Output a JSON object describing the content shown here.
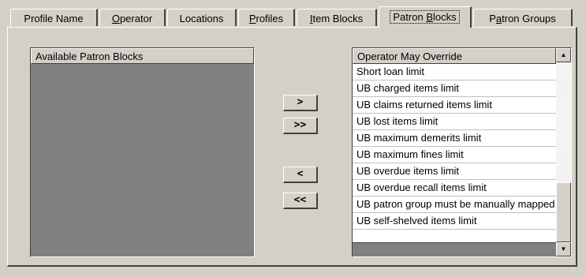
{
  "tabs": [
    {
      "pre": "Profile Name",
      "acc": "",
      "post": ""
    },
    {
      "pre": "",
      "acc": "O",
      "post": "perator"
    },
    {
      "pre": "Locations",
      "acc": "",
      "post": ""
    },
    {
      "pre": "",
      "acc": "P",
      "post": "rofiles"
    },
    {
      "pre": "",
      "acc": "I",
      "post": "tem Blocks"
    },
    {
      "pre": "Patron ",
      "acc": "B",
      "post": "locks"
    },
    {
      "pre": "P",
      "acc": "a",
      "post": "tron Groups"
    }
  ],
  "available": {
    "header": "Available Patron Blocks"
  },
  "buttons": {
    "add": ">",
    "add_all": ">>",
    "remove": "<",
    "remove_all": "<<"
  },
  "override": {
    "header": "Operator May Override",
    "items": [
      "Short loan limit",
      "UB charged items limit",
      "UB claims returned items limit",
      "UB lost items limit",
      "UB maximum demerits limit",
      "UB maximum fines limit",
      "UB overdue items limit",
      "UB overdue recall items limit",
      "UB patron group must be manually mapped",
      "UB self-shelved items limit"
    ]
  },
  "scrollbar": {
    "up_icon": "▲",
    "down_icon": "▼"
  }
}
